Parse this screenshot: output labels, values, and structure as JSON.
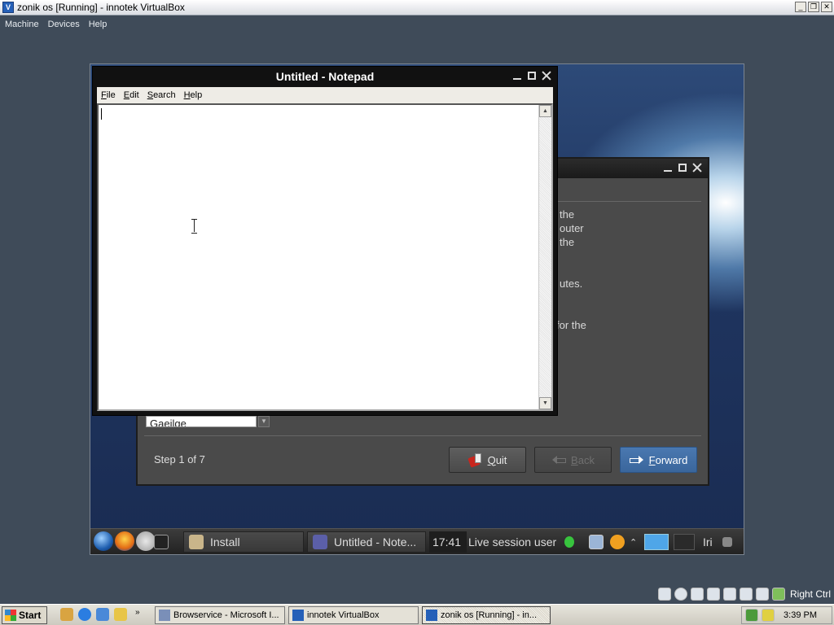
{
  "host_window": {
    "title": "zonik os [Running] - innotek VirtualBox",
    "icon": "virtualbox-icon",
    "controls": [
      "minimize",
      "restore",
      "close"
    ]
  },
  "host_menu": [
    "Machine",
    "Devices",
    "Help"
  ],
  "notepad": {
    "title": "Untitled - Notepad",
    "menu": [
      {
        "mnemonic": "F",
        "rest": "ile"
      },
      {
        "mnemonic": "E",
        "rest": "dit"
      },
      {
        "mnemonic": "S",
        "rest": "earch"
      },
      {
        "mnemonic": "H",
        "rest": "elp"
      }
    ],
    "content": ""
  },
  "installer": {
    "visible_text_fragments": [
      "the",
      "outer",
      "the",
      "utes.",
      "for the"
    ],
    "language_value": "Gaeilge",
    "step_label": "Step 1 of 7",
    "buttons": {
      "quit": {
        "mnemonic": "Q",
        "rest": "uit"
      },
      "back": {
        "mnemonic": "B",
        "rest": "ack"
      },
      "forward": {
        "mnemonic": "F",
        "rest": "orward"
      }
    }
  },
  "guest_taskbar": {
    "tasks": [
      "Install",
      "Untitled - Note..."
    ],
    "clock": "17:41",
    "user_label": "Live session user",
    "locale": "Iri"
  },
  "host_tray": {
    "right_ctrl": "Right Ctrl"
  },
  "windows_taskbar": {
    "start_label": "Start",
    "tasks": [
      "Browservice - Microsoft I...",
      "innotek VirtualBox",
      "zonik os [Running] - in..."
    ],
    "clock": "3:39 PM"
  },
  "colors": {
    "guest_taskbar": "#2e2e2e",
    "forward_button": "#3f6ea6",
    "installer_bg": "#4a4a4a",
    "host_bg": "#3f4b59"
  }
}
